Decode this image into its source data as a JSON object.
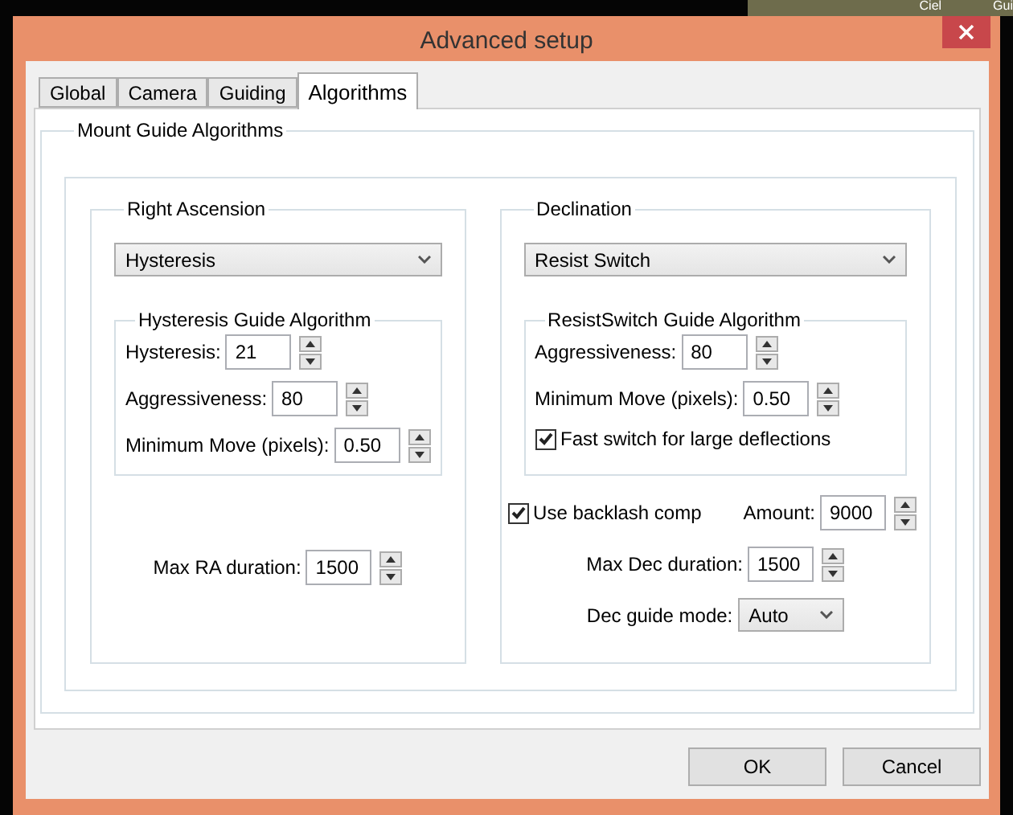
{
  "background": {
    "labels": [
      "Ciel",
      "Gui"
    ]
  },
  "window": {
    "title": "Advanced setup"
  },
  "tabs": [
    {
      "label": "Global",
      "selected": false
    },
    {
      "label": "Camera",
      "selected": false
    },
    {
      "label": "Guiding",
      "selected": false
    },
    {
      "label": "Algorithms",
      "selected": true
    }
  ],
  "group_title": "Mount Guide Algorithms",
  "right_ascension": {
    "title": "Right Ascension",
    "algorithm": "Hysteresis",
    "sub_title": "Hysteresis Guide Algorithm",
    "fields": [
      {
        "label": "Hysteresis:",
        "value": "21"
      },
      {
        "label": "Aggressiveness:",
        "value": "80"
      },
      {
        "label": "Minimum Move (pixels):",
        "value": "0.50"
      }
    ],
    "max_duration": {
      "label": "Max RA duration:",
      "value": "1500"
    }
  },
  "declination": {
    "title": "Declination",
    "algorithm": "Resist Switch",
    "sub_title": "ResistSwitch Guide Algorithm",
    "fields": [
      {
        "label": "Aggressiveness:",
        "value": "80"
      },
      {
        "label": "Minimum Move (pixels):",
        "value": "0.50"
      }
    ],
    "fast_switch": {
      "label": "Fast switch for large deflections",
      "checked": true
    },
    "backlash": {
      "label": "Use backlash comp",
      "checked": true,
      "amount_label": "Amount:",
      "amount": "9000"
    },
    "max_duration": {
      "label": "Max Dec duration:",
      "value": "1500"
    },
    "guide_mode": {
      "label": "Dec guide mode:",
      "value": "Auto"
    }
  },
  "buttons": [
    "OK",
    "Cancel"
  ]
}
